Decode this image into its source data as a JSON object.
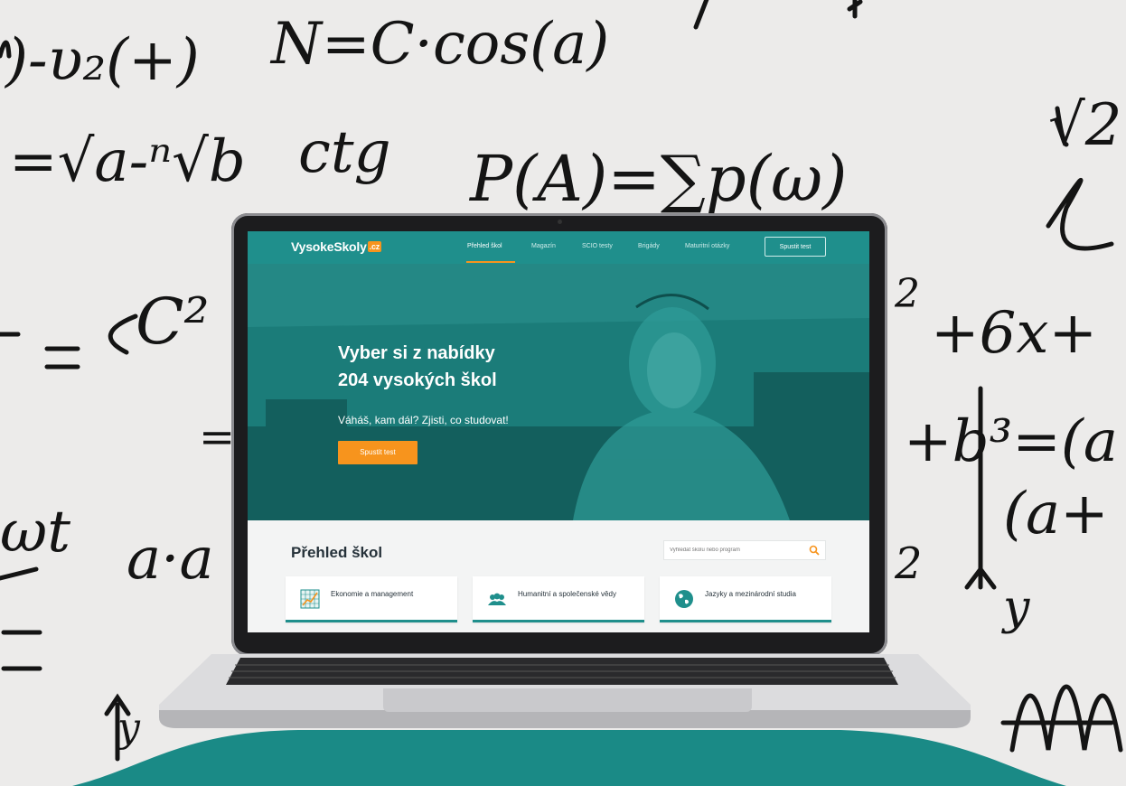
{
  "nav": {
    "logo_text": "VysokeSkoly",
    "logo_badge": ".cz",
    "links": [
      "Přehled škol",
      "Magazín",
      "SCIO testy",
      "Brigády",
      "Maturitní otázky"
    ],
    "button": "Spustit test"
  },
  "hero": {
    "title_line1": "Vyber si z nabídky",
    "title_line2": "204 vysokých škol",
    "subtitle": "Váháš, kam dál? Zjisti, co studovat!",
    "button": "Spustit test"
  },
  "section": {
    "title": "Přehled škol",
    "search_placeholder": "Vyhledat školu nebo program",
    "categories": [
      {
        "label": "Ekonomie a management",
        "icon": "chart-icon"
      },
      {
        "label": "Humanitní a společenské vědy",
        "icon": "people-icon"
      },
      {
        "label": "Jazyky a mezinárodní studia",
        "icon": "globe-icon"
      }
    ]
  },
  "colors": {
    "brand_teal": "#1f8f8c",
    "accent_orange": "#f7941d",
    "background_teal_blob": "#1a8a86"
  }
}
